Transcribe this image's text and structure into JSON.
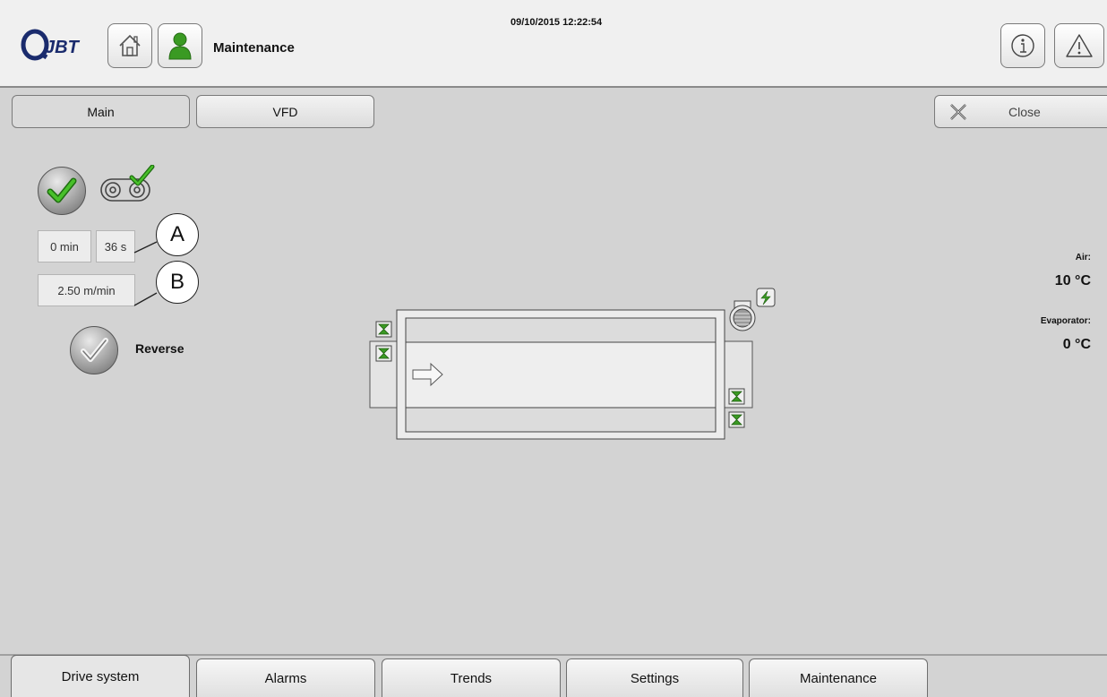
{
  "header": {
    "logo_text": "JBT",
    "title": "Maintenance",
    "datetime": "09/10/2015 12:22:54",
    "icons": {
      "home": "home-icon",
      "user": "user-icon",
      "info": "info-icon",
      "warning": "warning-icon"
    }
  },
  "subtabs": [
    {
      "label": "Main"
    },
    {
      "label": "VFD"
    }
  ],
  "close": {
    "label": "Close"
  },
  "status": {
    "time_min": "0 min",
    "time_sec": "36 s",
    "speed": "2.50 m/min",
    "reverse_label": "Reverse",
    "callouts": [
      "A",
      "B"
    ]
  },
  "readouts": {
    "air_label": "Air:",
    "air_value": "10 °C",
    "evap_label": "Evaporator:",
    "evap_value": "0 °C"
  },
  "bottom_tabs": [
    {
      "label": "Drive system"
    },
    {
      "label": "Alarms"
    },
    {
      "label": "Trends"
    },
    {
      "label": "Settings"
    },
    {
      "label": "Maintenance"
    }
  ],
  "colors": {
    "accent_green": "#3a9a23",
    "background": "#d3d3d3"
  }
}
